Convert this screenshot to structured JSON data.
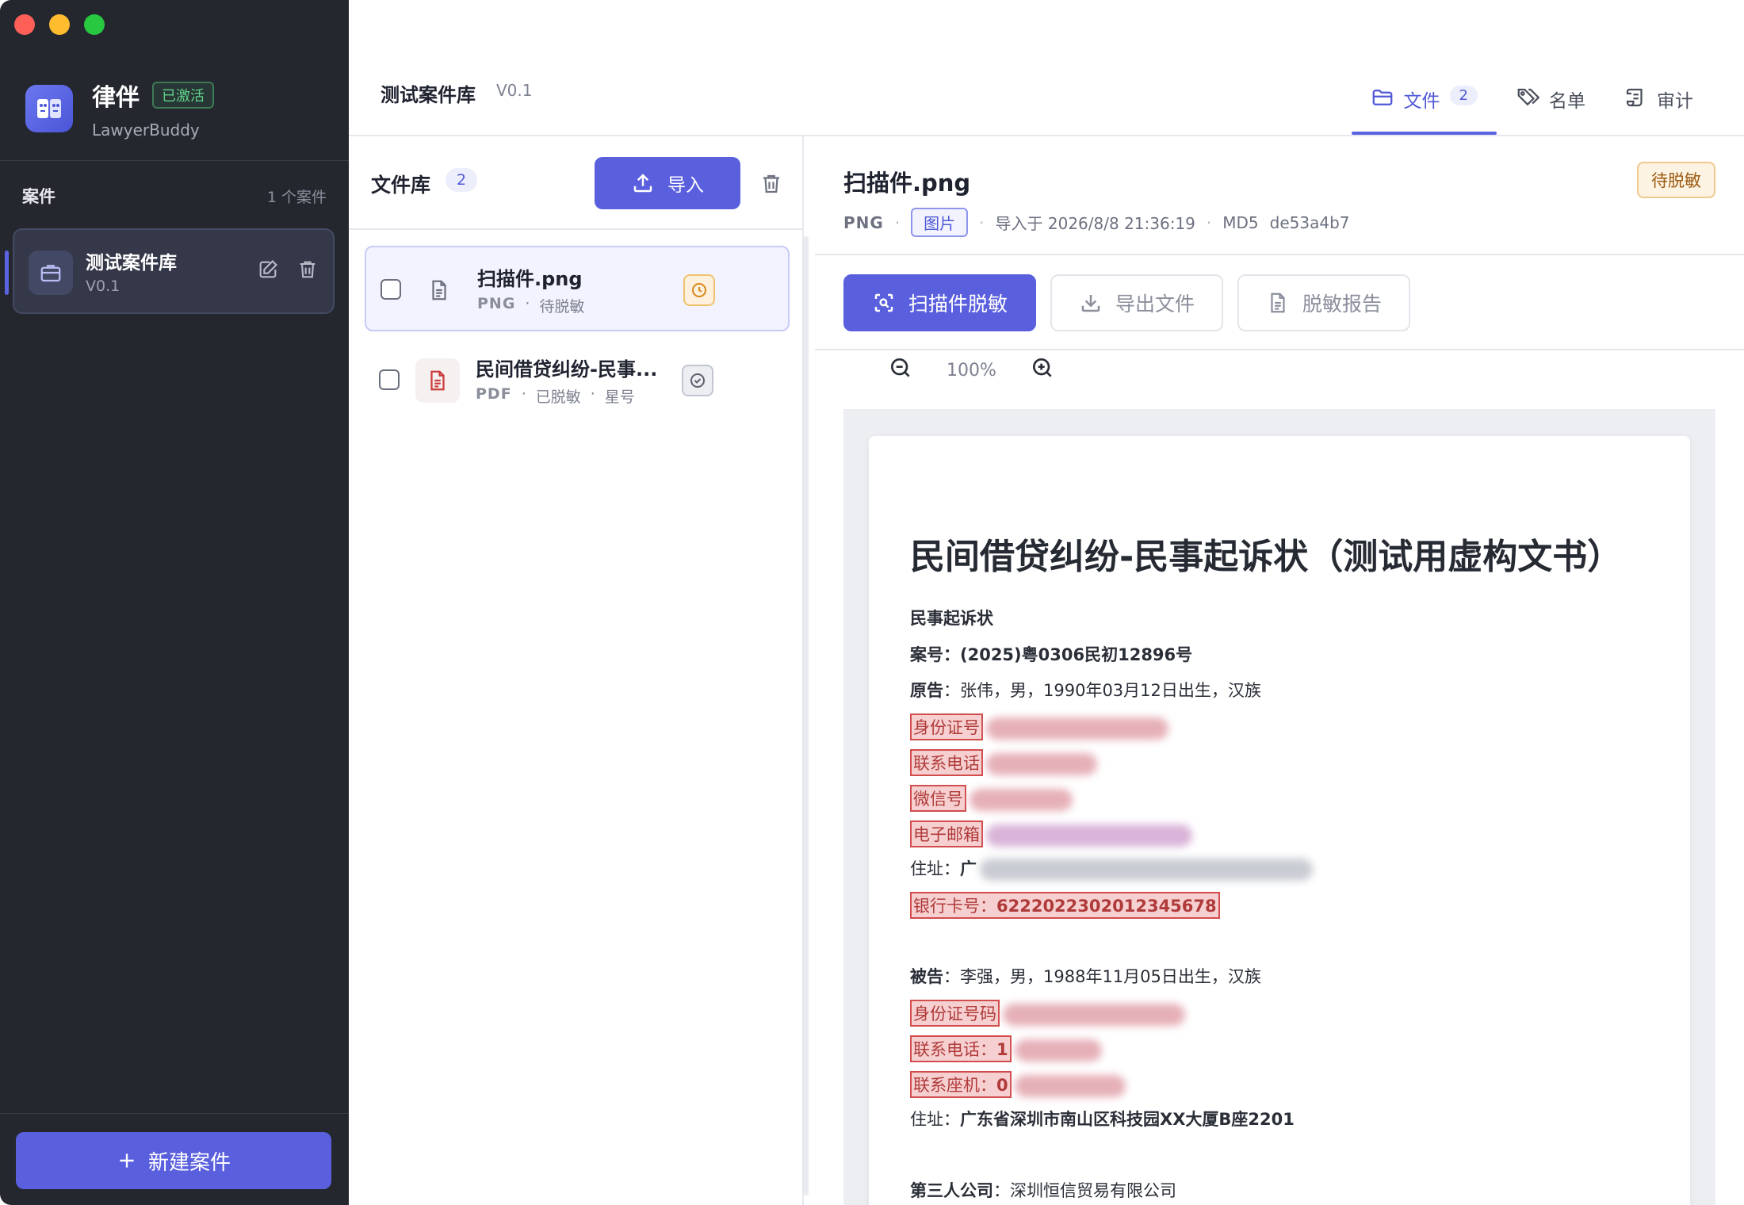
{
  "sidebar": {
    "app_name": "律伴",
    "app_badge": "已激活",
    "app_subtitle": "LawyerBuddy",
    "cases_title": "案件",
    "cases_count": "1 个案件",
    "case": {
      "name": "测试案件库",
      "version": "V0.1"
    },
    "new_case_label": "新建案件"
  },
  "header": {
    "title": "测试案件库",
    "version": "V0.1",
    "tabs": [
      {
        "label": "文件",
        "count": "2",
        "icon": "folder-icon",
        "active": true
      },
      {
        "label": "名单",
        "icon": "tags-icon",
        "active": false
      },
      {
        "label": "审计",
        "icon": "scroll-icon",
        "active": false
      }
    ]
  },
  "files": {
    "title": "文件库",
    "count": "2",
    "import_label": "导入",
    "items": [
      {
        "name": "扫描件.png",
        "type": "PNG",
        "status": "待脱敏",
        "extra": "",
        "status_icon": "clock-icon"
      },
      {
        "name": "民间借贷纠纷-民事...",
        "type": "PDF",
        "status": "已脱敏",
        "extra": "星号",
        "status_icon": "check-circle-icon"
      }
    ]
  },
  "preview": {
    "title": "扫描件.png",
    "badge": "待脱敏",
    "type": "PNG",
    "tag": "图片",
    "imported": "导入于 2026/8/8 21:36:19",
    "md5_label": "MD5",
    "md5": "de53a4b7",
    "actions": {
      "scan": "扫描件脱敏",
      "export": "导出文件",
      "report": "脱敏报告"
    },
    "zoom": "100%"
  },
  "document": {
    "title": "民间借贷纠纷-民事起诉状（测试用虚构文书）",
    "heading": "民事起诉状",
    "case_no_label": "案号",
    "case_no": "(2025)粤0306民初12896号",
    "plaintiff_label": "原告",
    "plaintiff": "张伟，男，1990年03月12日出生，汉族",
    "p_id_label": "身份证号",
    "p_phone_label": "联系电话",
    "p_wechat_label": "微信号",
    "p_email_label": "电子邮箱",
    "p_addr_label": "住址",
    "p_addr_head": "广",
    "p_bank_label": "银行卡号",
    "p_bank": "6222022302012345678",
    "defendant_label": "被告",
    "defendant": "李强，男，1988年11月05日出生，汉族",
    "d_id_label": "身份证号码",
    "d_phone_label": "联系电话",
    "d_phone_head": "1",
    "d_landline_label": "联系座机",
    "d_landline_head": "0",
    "d_addr_label": "住址",
    "d_addr": "广东省深圳市南山区科技园XX大厦B座2201",
    "third_label": "第三人公司",
    "third": "深圳恒信贸易有限公司"
  }
}
